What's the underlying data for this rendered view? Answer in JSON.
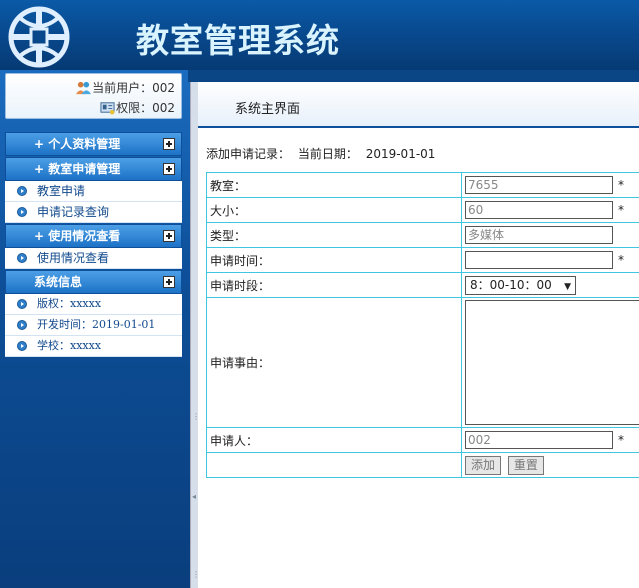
{
  "app": {
    "title": "教室管理系统"
  },
  "user": {
    "current_user_label": "当前用户：",
    "current_user": "002",
    "permission_label": "权限：",
    "permission": "002"
  },
  "menu": {
    "sections": [
      {
        "label": "+ 个人资料管理"
      },
      {
        "label": "+ 教室申请管理",
        "items": [
          "教室申请",
          "申请记录查询"
        ]
      },
      {
        "label": "+ 使用情况查看",
        "items": [
          "使用情况查看"
        ]
      },
      {
        "label": "系统信息",
        "items": [
          "版权：xxxxx",
          "开发时间：2019-01-01",
          "学校：xxxxx"
        ]
      }
    ]
  },
  "tabs": {
    "main": "系统主界面"
  },
  "record": {
    "heading": "添加申请记录：",
    "date_label": "当前日期：",
    "date": "2019-01-01"
  },
  "form": {
    "classroom": {
      "label": "教室：",
      "value": "7655",
      "required": "*"
    },
    "size": {
      "label": "大小：",
      "value": "60",
      "required": "*"
    },
    "type": {
      "label": "类型：",
      "value": "多媒体"
    },
    "apply_time": {
      "label": "申请时间：",
      "value": "",
      "required": "*"
    },
    "period": {
      "label": "申请时段：",
      "value": "8：00-10：00"
    },
    "reason": {
      "label": "申请事由：",
      "value": ""
    },
    "applicant": {
      "label": "申请人：",
      "value": "002",
      "required": "*"
    },
    "add_button": "添加",
    "reset_button": "重置"
  },
  "colors": {
    "header": "#08478a",
    "title_text": "#d9f4ff",
    "table_border": "#41c6e0",
    "menu_header": "#1d72c6"
  }
}
